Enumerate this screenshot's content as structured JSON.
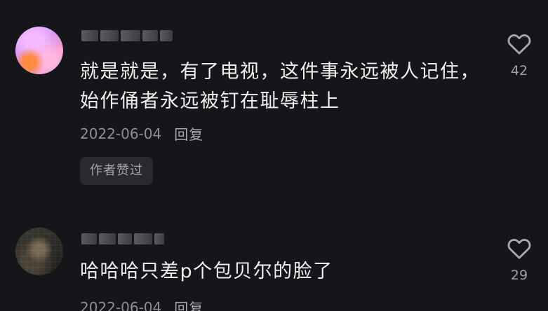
{
  "comments": [
    {
      "text": "就是就是，有了电视，这件事永远被人记住，始作俑者永远被钉在耻辱柱上",
      "date": "2022-06-04",
      "reply_label": "回复",
      "badge": "作者赞过",
      "likes": "42",
      "icon": "heart-outline-icon"
    },
    {
      "text": "哈哈哈只差p个包贝尔的脸了",
      "date": "2022-06-04",
      "reply_label": "回复",
      "likes": "29",
      "icon": "heart-outline-icon"
    }
  ],
  "colors": {
    "background": "#16161a",
    "text": "#efefef",
    "meta": "#8d8d92",
    "badge_bg": "#2a2a2e"
  }
}
